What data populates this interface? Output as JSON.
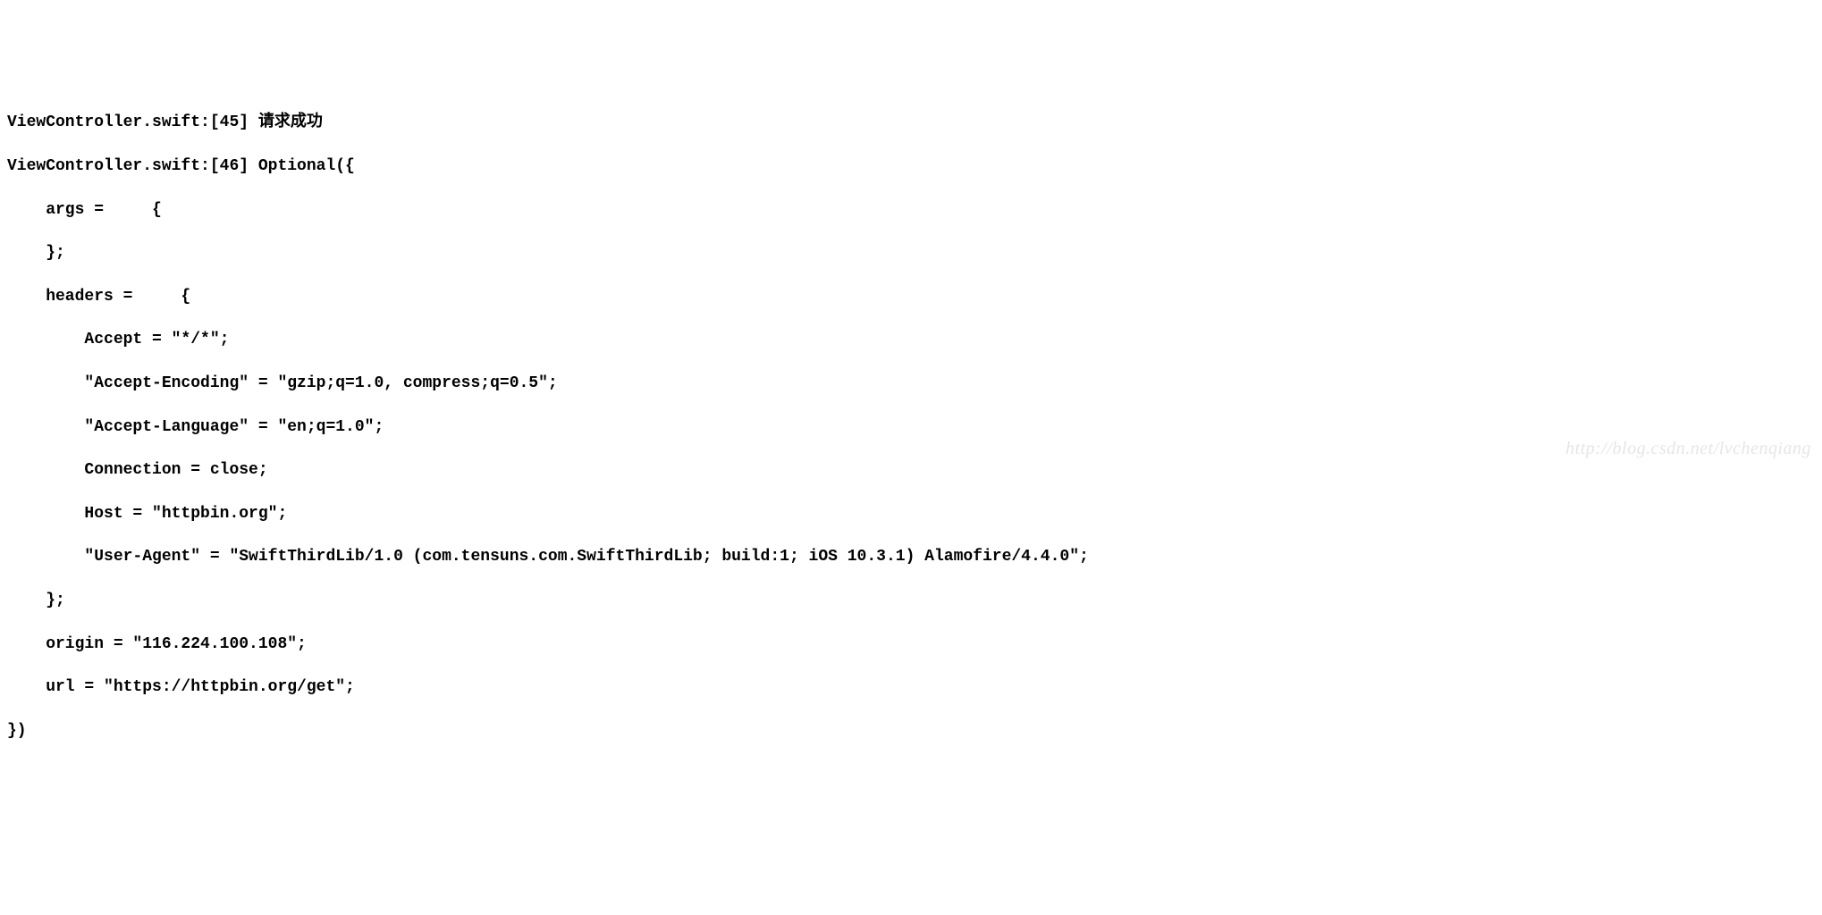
{
  "console": {
    "lines": [
      "ViewController.swift:[45] 请求成功",
      "ViewController.swift:[46] Optional({",
      "    args =     {",
      "    };",
      "    headers =     {",
      "        Accept = \"*/*\";",
      "        \"Accept-Encoding\" = \"gzip;q=1.0, compress;q=0.5\";",
      "        \"Accept-Language\" = \"en;q=1.0\";",
      "        Connection = close;",
      "        Host = \"httpbin.org\";",
      "        \"User-Agent\" = \"SwiftThirdLib/1.0 (com.tensuns.com.SwiftThirdLib; build:1; iOS 10.3.1) Alamofire/4.4.0\";",
      "    };",
      "    origin = \"116.224.100.108\";",
      "    url = \"https://httpbin.org/get\";",
      "})"
    ]
  },
  "watermark": {
    "text": "http://blog.csdn.net/lvchenqiang"
  }
}
